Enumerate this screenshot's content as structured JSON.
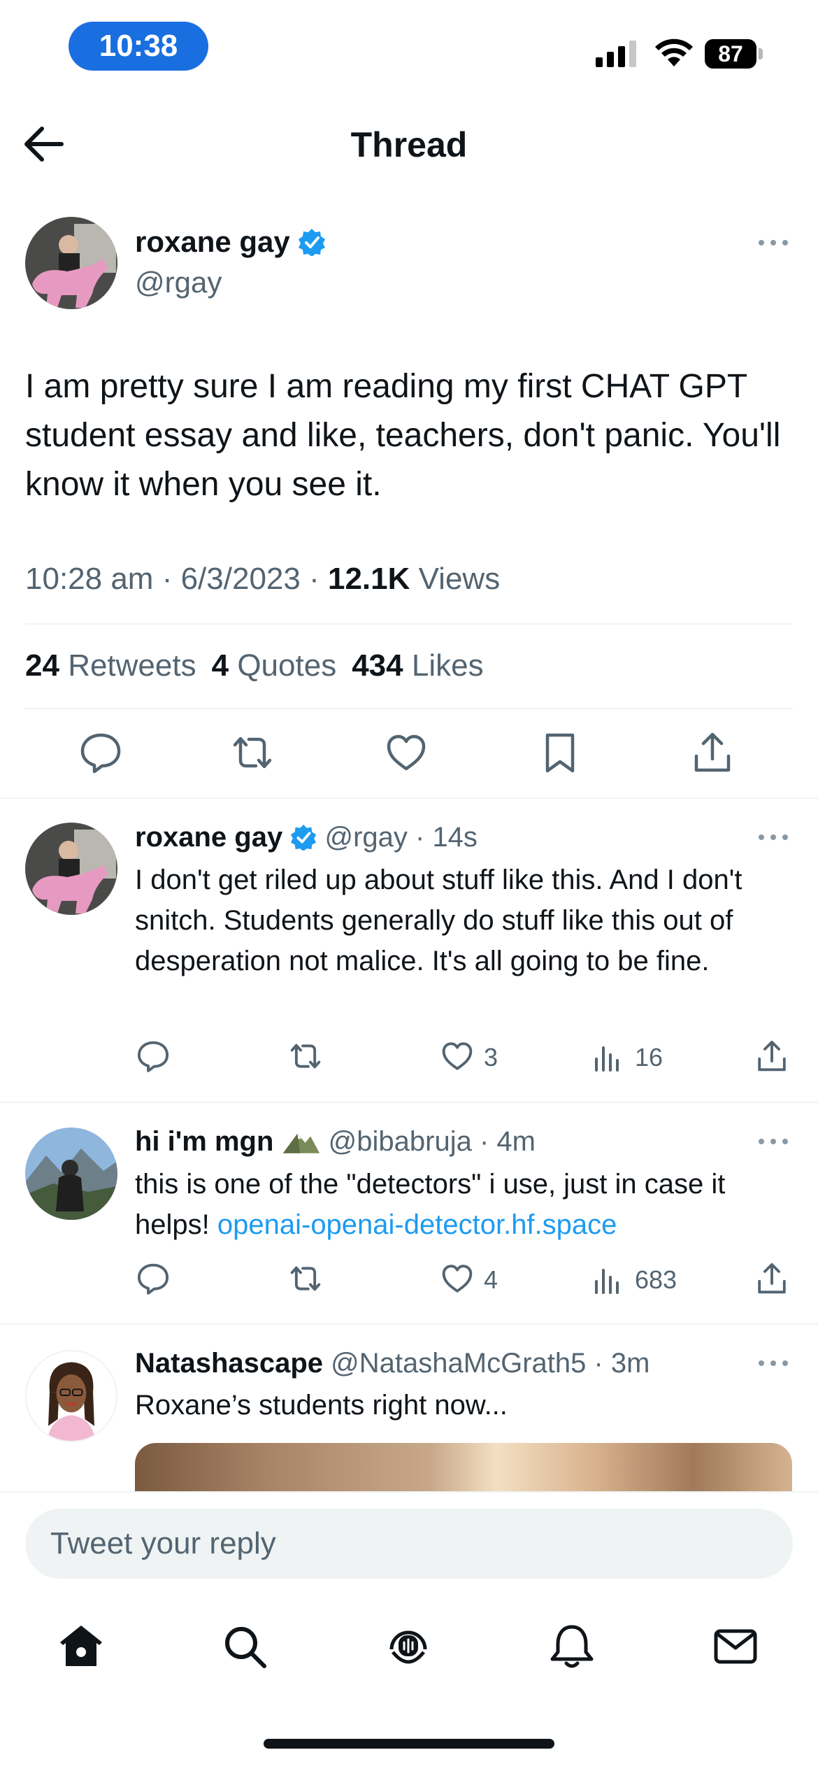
{
  "status_bar": {
    "time": "10:38",
    "battery": "87"
  },
  "nav": {
    "title": "Thread"
  },
  "main_tweet": {
    "name": "roxane gay",
    "handle": "@rgay",
    "text": "I am pretty sure I am reading my first CHAT GPT student essay and like, teachers, don't panic. You'll know it when you see it.",
    "time": "10:28 am",
    "date": "6/3/2023",
    "views_count": "12.1K",
    "views_label": "Views",
    "retweets_count": "24",
    "retweets_label": "Retweets",
    "quotes_count": "4",
    "quotes_label": "Quotes",
    "likes_count": "434",
    "likes_label": "Likes"
  },
  "replies": [
    {
      "name": "roxane gay",
      "handle": "@rgay",
      "time": "14s",
      "text": "I don't get riled up about stuff like this. And I don't snitch. Students generally do stuff like this out of desperation not malice. It's all going to be fine.",
      "likes": "3",
      "views": "16"
    },
    {
      "name": "hi i'm mgn",
      "handle": "@bibabruja",
      "time": "4m",
      "text": "this is one of the \"detectors\" i use, just in case it helps!",
      "link": "openai-openai-detector.hf.space",
      "likes": "4",
      "views": "683"
    },
    {
      "name": "Natashascape",
      "handle": "@NatashaMcGrath5",
      "time": "3m",
      "text": "Roxane’s students right now..."
    }
  ],
  "composer": {
    "placeholder": "Tweet your reply"
  },
  "colors": {
    "accent": "#1d9bf0",
    "text": "#0f1419",
    "muted": "#536471",
    "divider": "#eff3f4",
    "time_pill": "#1a6fe0"
  },
  "icons": [
    "back-arrow-icon",
    "verified-badge-icon",
    "more-icon",
    "reply-icon",
    "retweet-icon",
    "like-icon",
    "bookmark-icon",
    "share-icon",
    "views-icon",
    "home-icon",
    "search-icon",
    "spaces-icon",
    "notifications-icon",
    "messages-icon"
  ]
}
